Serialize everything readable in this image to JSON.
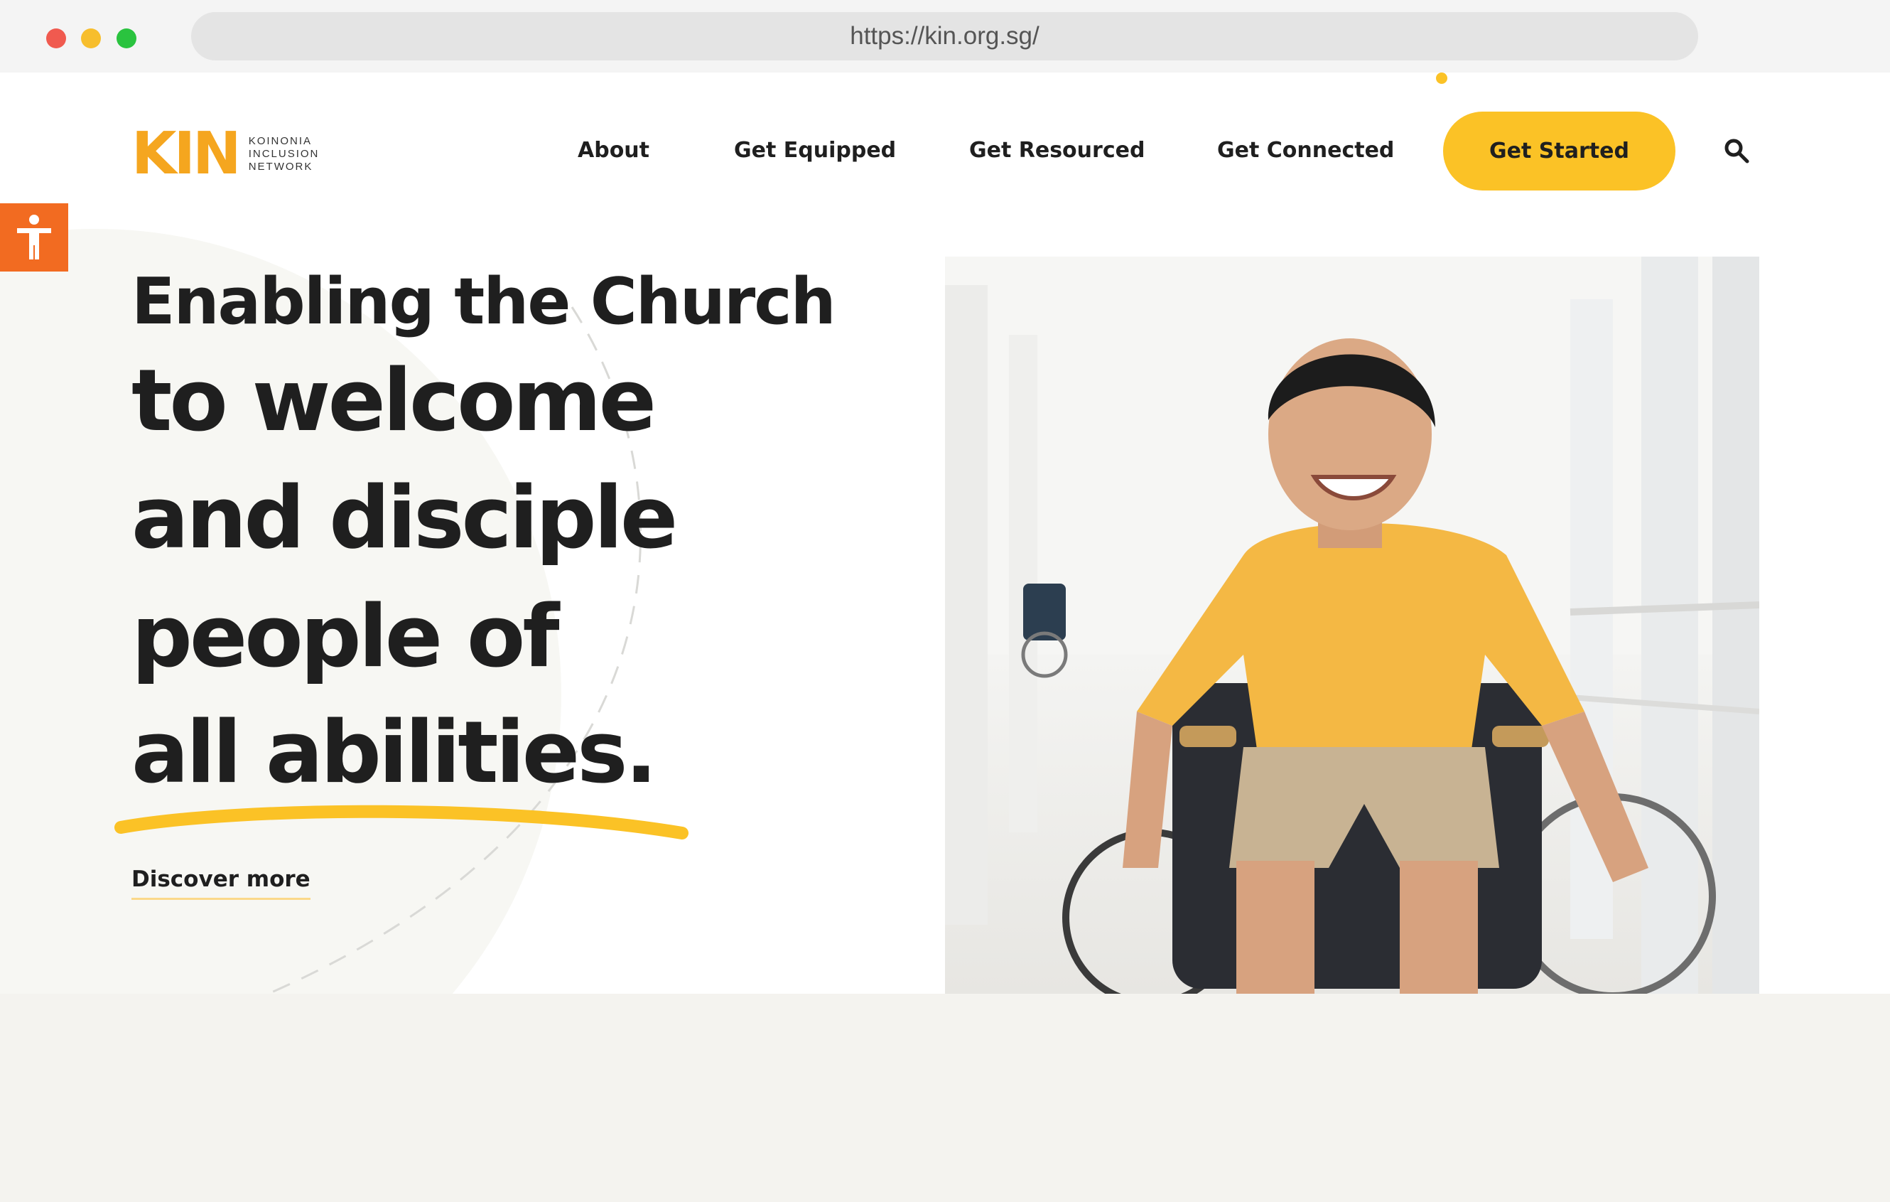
{
  "browser": {
    "url": "https://kin.org.sg/"
  },
  "logo": {
    "mark": "KIN",
    "text_lines": [
      "KOINONIA",
      "INCLUSION",
      "NETWORK"
    ]
  },
  "nav": {
    "items": [
      {
        "label": "About"
      },
      {
        "label": "Get Equipped"
      },
      {
        "label": "Get Resourced"
      },
      {
        "label": "Get Connected"
      }
    ],
    "cta_label": "Get Started"
  },
  "hero": {
    "line_1": "Enabling the Church",
    "line_2": "to welcome",
    "line_3": "and disciple",
    "line_4": "people of",
    "line_5": "all abilities.",
    "link_label": "Discover more"
  },
  "colors": {
    "accent_yellow": "#fbc226",
    "logo_orange": "#f5a61f",
    "accessibility_orange": "#f26b21",
    "text_dark": "#1f1f1f"
  },
  "icons": {
    "search": "search-icon",
    "accessibility": "accessibility-icon"
  }
}
